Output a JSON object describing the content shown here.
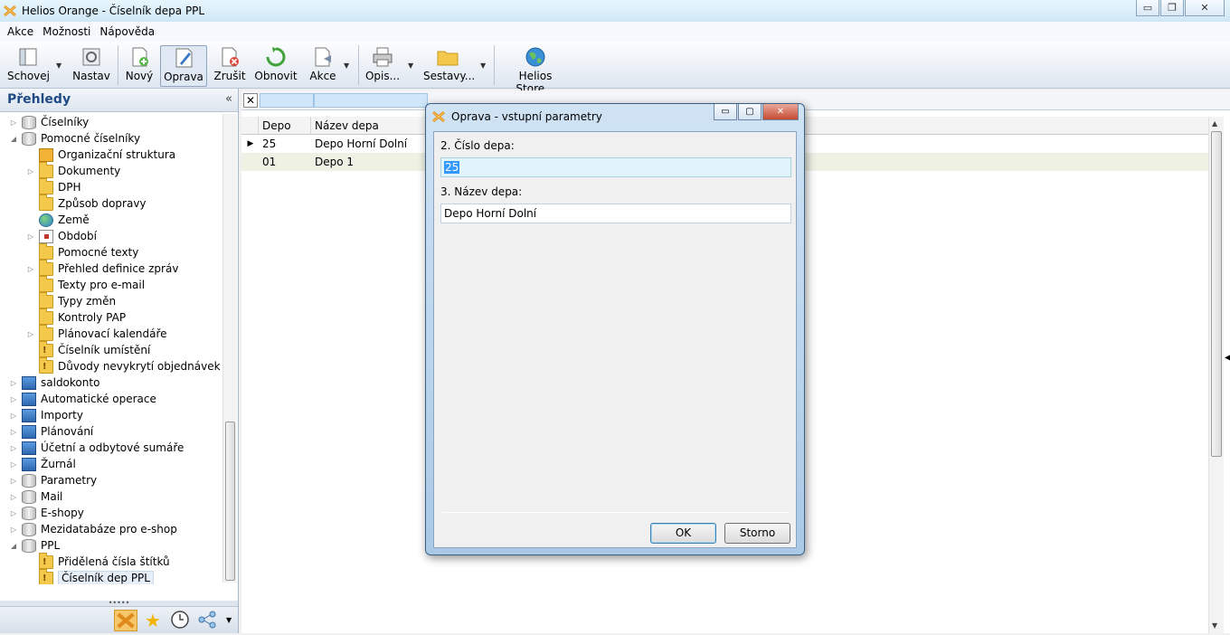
{
  "window": {
    "title": "Helios Orange - Číselník depa PPL"
  },
  "menu": {
    "items": [
      "Akce",
      "Možnosti",
      "Nápověda"
    ]
  },
  "toolbar": {
    "buttons": [
      "Schovej",
      "Nastav",
      "Nový",
      "Oprava",
      "Zrušit",
      "Obnovit",
      "Akce",
      "Opis...",
      "Sestavy...",
      "Helios Store..."
    ]
  },
  "sidebar": {
    "title": "Přehledy",
    "collapse": "«",
    "tree": [
      "Číselníky",
      "Pomocné číselníky",
      "Organizační struktura",
      "Dokumenty",
      "DPH",
      "Způsob dopravy",
      "Země",
      "Období",
      "Pomocné texty",
      "Přehled definice zpráv",
      "Texty pro e-mail",
      "Typy změn",
      "Kontroly PAP",
      "Plánovací kalendáře",
      "Číselník umístění",
      "Důvody nevykrytí objednávek",
      "saldokonto",
      "Automatické operace",
      "Importy",
      "Plánování",
      "Účetní a odbytové sumáře",
      "Žurnál",
      "Parametry",
      "Mail",
      "E-shopy",
      "Mezidatabáze pro e-shop",
      "PPL",
      "Přidělená čísla štítků",
      "Číselník dep PPL"
    ]
  },
  "grid": {
    "columns": [
      "Depo",
      "Název depa"
    ],
    "rows": [
      {
        "depo": "25",
        "nazev": "Depo Horní Dolní"
      },
      {
        "depo": "01",
        "nazev": "Depo 1"
      }
    ]
  },
  "dialog": {
    "title": "Oprava - vstupní parametry",
    "field1_label": "2. Číslo depa:",
    "field1_value": "25",
    "field2_label": "3. Název depa:",
    "field2_value": "Depo Horní Dolní",
    "ok": "OK",
    "cancel": "Storno"
  },
  "colors": {
    "accent": "#1e4a85",
    "selection": "#3399ff",
    "dialog_frame": "#a9c9e6"
  }
}
